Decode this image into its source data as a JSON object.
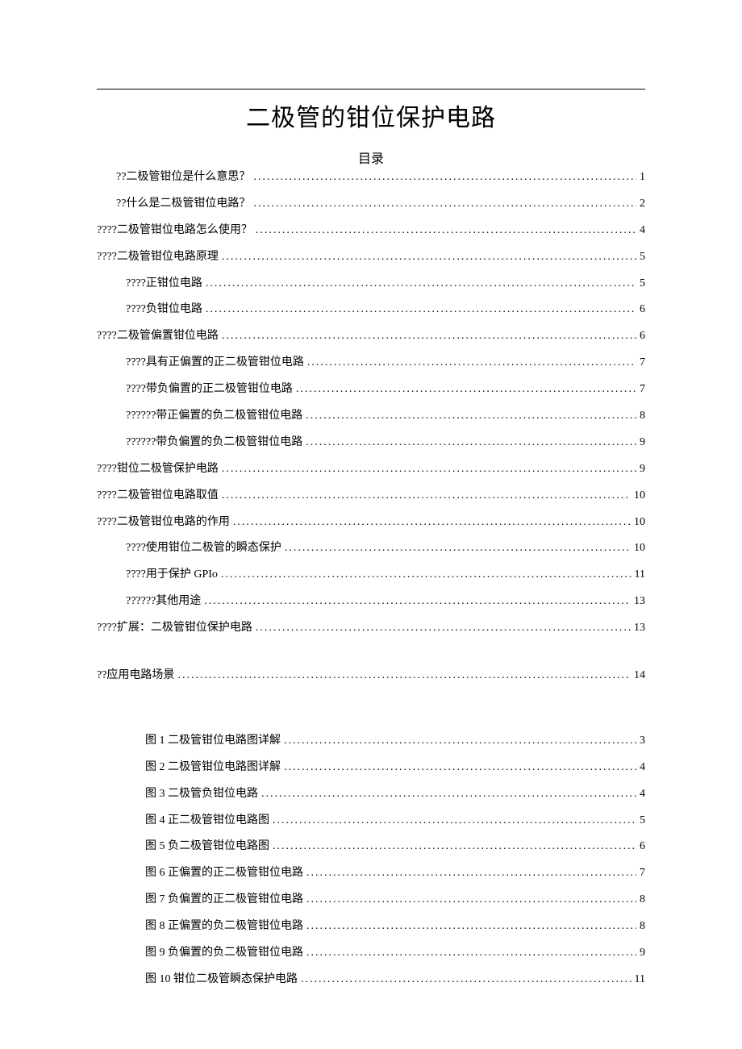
{
  "title": "二极管的钳位保护电路",
  "toc_heading": "目录",
  "toc": [
    {
      "label": "??二极管钳位是什么意思？",
      "page": "1",
      "indent": 1
    },
    {
      "label": "??什么是二极管钳位电路？",
      "page": "2",
      "indent": 1
    },
    {
      "label": "????二极管钳位电路怎么使用？",
      "page": "4",
      "indent": 0
    },
    {
      "label": "????二极管钳位电路原理",
      "page": "5",
      "indent": 0
    },
    {
      "label": "????正钳位电路",
      "page": "5",
      "indent": 2
    },
    {
      "label": "????负钳位电路",
      "page": "6",
      "indent": 2
    },
    {
      "label": "????二极管偏置钳位电路",
      "page": "6",
      "indent": 0
    },
    {
      "label": "????具有正偏置的正二极管钳位电路",
      "page": "7",
      "indent": 2
    },
    {
      "label": "????带负偏置的正二极管钳位电路",
      "page": "7",
      "indent": 2
    },
    {
      "label": "??????带正偏置的负二极管钳位电路",
      "page": "8",
      "indent": 2
    },
    {
      "label": "??????带负偏置的负二极管钳位电路",
      "page": "9",
      "indent": 2
    },
    {
      "label": "????钳位二极管保护电路",
      "page": "9",
      "indent": 0
    },
    {
      "label": "????二极管钳位电路取值",
      "page": "10",
      "indent": 0
    },
    {
      "label": "????二极管钳位电路的作用",
      "page": "10",
      "indent": 0
    },
    {
      "label": "????使用钳位二极管的瞬态保护",
      "page": "10",
      "indent": 2
    },
    {
      "label": "????用于保护 GPIo",
      "page": "11",
      "indent": 2
    },
    {
      "label": "??????其他用途",
      "page": "13",
      "indent": 2
    },
    {
      "label": "????扩展：二极管钳位保护电路",
      "page": "13",
      "indent": 0
    }
  ],
  "toc_tail": [
    {
      "label": "??应用电路场景",
      "page": "14",
      "indent": 0
    }
  ],
  "figures": [
    {
      "label": "图 1 二极管钳位电路图详解",
      "page": "3"
    },
    {
      "label": "图 2 二极管钳位电路图详解",
      "page": "4"
    },
    {
      "label": "图 3 二极管负钳位电路",
      "page": "4"
    },
    {
      "label": "图 4 正二极管钳位电路图",
      "page": "5"
    },
    {
      "label": "图 5 负二极管钳位电路图",
      "page": "6"
    },
    {
      "label": "图 6 正偏置的正二极管钳位电路",
      "page": "7"
    },
    {
      "label": "图 7 负偏置的正二极管钳位电路",
      "page": "8"
    },
    {
      "label": "图 8 正偏置的负二极管钳位电路",
      "page": "8"
    },
    {
      "label": "图 9 负偏置的负二极管钳位电路",
      "page": "9"
    },
    {
      "label": "图 10 钳位二极管瞬态保护电路",
      "page": "11"
    }
  ]
}
